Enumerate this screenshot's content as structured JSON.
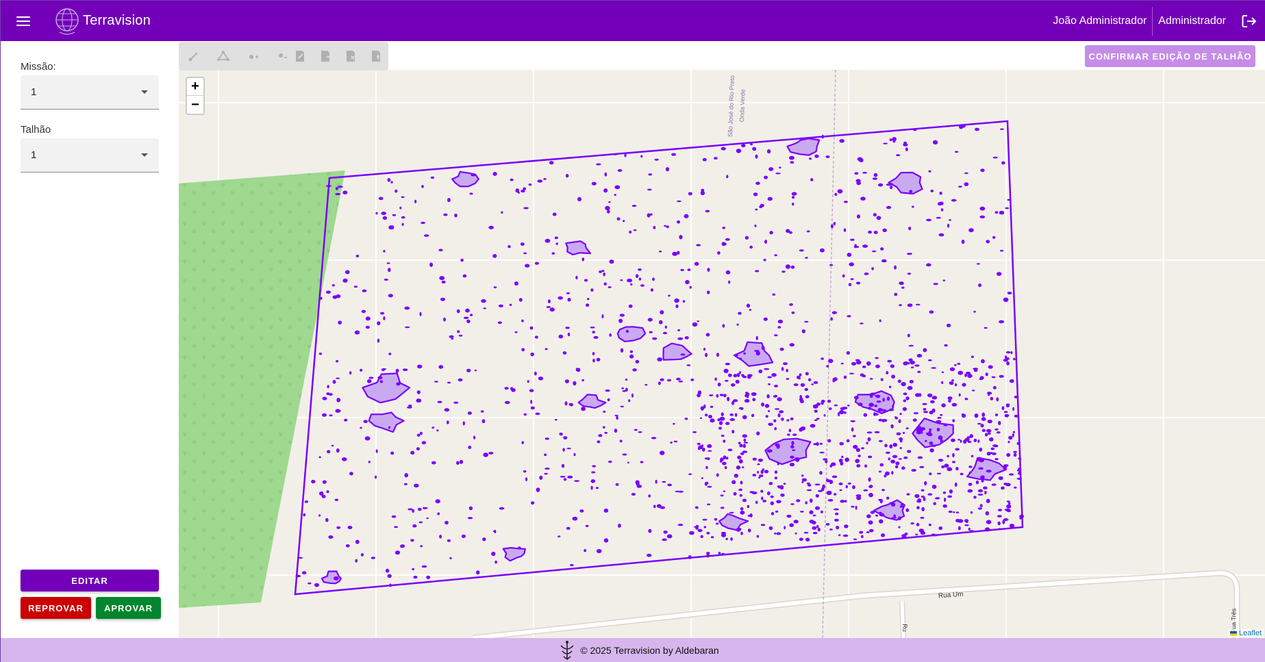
{
  "header": {
    "title": "Terravision",
    "user_name": "João Administrador",
    "user_role": "Administrador"
  },
  "sidebar": {
    "mission_label": "Missão:",
    "mission_value": "1",
    "plot_label": "Talhão",
    "plot_value": "1",
    "edit_button": "EDITAR",
    "reject_button": "REPROVAR",
    "approve_button": "APROVAR"
  },
  "map": {
    "confirm_button": "CONFIRMAR EDIÇÃO DE TALHÃO",
    "zoom_in": "+",
    "zoom_out": "−",
    "attribution": "Leaflet",
    "road_label": "Rua Um",
    "street_label_1": "São José do Rio Preto",
    "street_label_2": "Onda Verde",
    "street_label_3": "Rua Três",
    "street_label_4": "Ru",
    "draw_tools": [
      "draw-line-icon",
      "draw-polygon-icon",
      "add-vertex-icon",
      "remove-vertex-icon"
    ],
    "edit_tools": [
      "edit-layer-icon",
      "add-layer-icon",
      "delete-layer-icon",
      "upload-layer-icon"
    ]
  },
  "footer": {
    "copyright": "© 2025 Terravision by Aldebaran"
  },
  "colors": {
    "primary": "#7300b8",
    "footer_bg": "#d6b6ec",
    "reject": "#cc0000",
    "approve": "#00862e",
    "detection": "#7b00ff",
    "field_green": "#9fd88f"
  }
}
